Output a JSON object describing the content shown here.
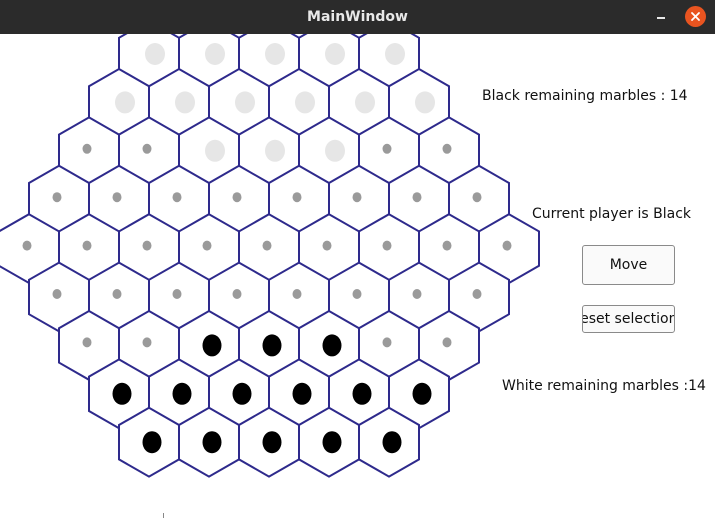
{
  "window": {
    "title": "MainWindow",
    "minimize_icon": "minimize-icon",
    "close_icon": "close-icon",
    "close_color": "#e95420"
  },
  "status": {
    "black_remaining": "Black remaining marbles : 14",
    "current_player": "Current player is Black",
    "white_remaining": "White remaining marbles :14"
  },
  "buttons": {
    "move": "Move",
    "reset": "Reset selection"
  },
  "board": {
    "hex_color": "#2e2a8c",
    "rows": [
      [
        "white",
        "white",
        "white",
        "white",
        "white"
      ],
      [
        "white",
        "white",
        "white",
        "white",
        "white",
        "white"
      ],
      [
        "empty",
        "empty",
        "white",
        "white",
        "white",
        "empty",
        "empty"
      ],
      [
        "empty",
        "empty",
        "empty",
        "empty",
        "empty",
        "empty",
        "empty",
        "empty"
      ],
      [
        "empty",
        "empty",
        "empty",
        "empty",
        "empty",
        "empty",
        "empty",
        "empty",
        "empty"
      ],
      [
        "empty",
        "empty",
        "empty",
        "empty",
        "empty",
        "empty",
        "empty",
        "empty"
      ],
      [
        "empty",
        "empty",
        "black",
        "black",
        "black",
        "empty",
        "empty"
      ],
      [
        "black",
        "black",
        "black",
        "black",
        "black",
        "black"
      ],
      [
        "black",
        "black",
        "black",
        "black",
        "black"
      ]
    ]
  }
}
